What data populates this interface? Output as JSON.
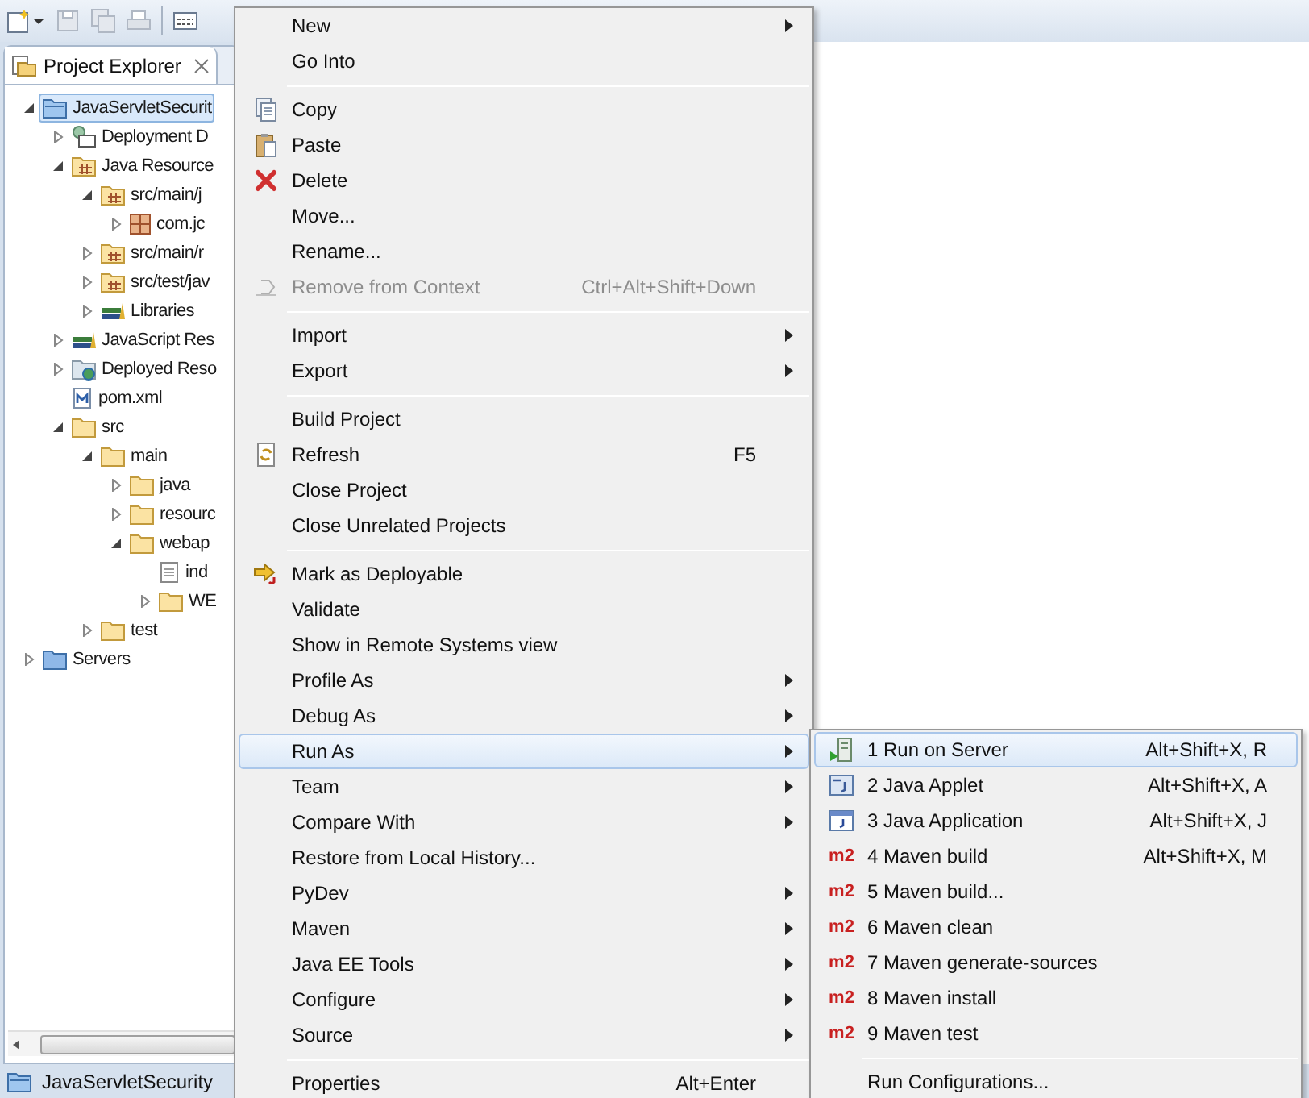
{
  "explorer": {
    "tab": {
      "title": "Project Explorer"
    },
    "tree": [
      {
        "label": "JavaServletSecurit",
        "kind": "project",
        "expanded": true,
        "selected": true,
        "children": [
          {
            "label": "Deployment D",
            "kind": "descriptor",
            "expanded": false,
            "selected": false
          },
          {
            "label": "Java Resource",
            "kind": "java-resources",
            "expanded": true,
            "selected": false,
            "children": [
              {
                "label": "src/main/j",
                "kind": "source-folder",
                "expanded": true,
                "selected": false,
                "children": [
                  {
                    "label": "com.jc",
                    "kind": "package",
                    "expanded": false,
                    "selected": false
                  }
                ]
              },
              {
                "label": "src/main/r",
                "kind": "source-folder",
                "expanded": false,
                "selected": false
              },
              {
                "label": "src/test/jav",
                "kind": "source-folder",
                "expanded": false,
                "selected": false
              },
              {
                "label": "Libraries",
                "kind": "library",
                "expanded": false,
                "selected": false
              }
            ]
          },
          {
            "label": "JavaScript Res",
            "kind": "library",
            "expanded": false,
            "selected": false
          },
          {
            "label": "Deployed Reso",
            "kind": "deployed",
            "expanded": false,
            "selected": false
          },
          {
            "label": "pom.xml",
            "kind": "maven-file",
            "selected": false
          },
          {
            "label": "src",
            "kind": "folder",
            "expanded": true,
            "selected": false,
            "children": [
              {
                "label": "main",
                "kind": "folder",
                "expanded": true,
                "selected": false,
                "children": [
                  {
                    "label": "java",
                    "kind": "folder",
                    "expanded": false,
                    "selected": false
                  },
                  {
                    "label": "resourc",
                    "kind": "folder",
                    "expanded": false,
                    "selected": false
                  },
                  {
                    "label": "webap",
                    "kind": "folder",
                    "expanded": true,
                    "selected": false,
                    "children": [
                      {
                        "label": "ind",
                        "kind": "file",
                        "selected": false
                      },
                      {
                        "label": "WE",
                        "kind": "folder",
                        "expanded": false,
                        "selected": false
                      }
                    ]
                  }
                ]
              },
              {
                "label": "test",
                "kind": "folder",
                "expanded": false,
                "selected": false
              }
            ]
          }
        ]
      },
      {
        "label": "Servers",
        "kind": "servers",
        "expanded": false,
        "selected": false
      }
    ]
  },
  "status_bar": {
    "label": "JavaServletSecurity"
  },
  "context_menu": {
    "items": [
      {
        "kind": "plain",
        "label": "New",
        "submenu": true,
        "disabled": false,
        "selected": false
      },
      {
        "kind": "plain",
        "label": "Go Into",
        "submenu": false,
        "disabled": false,
        "selected": false
      },
      {
        "kind": "separator"
      },
      {
        "kind": "copy",
        "label": "Copy",
        "submenu": false,
        "disabled": false,
        "selected": false
      },
      {
        "kind": "paste",
        "label": "Paste",
        "submenu": false,
        "disabled": false,
        "selected": false
      },
      {
        "kind": "delete",
        "label": "Delete",
        "submenu": false,
        "disabled": false,
        "selected": false
      },
      {
        "kind": "plain",
        "label": "Move...",
        "submenu": false,
        "disabled": false,
        "selected": false
      },
      {
        "kind": "plain",
        "label": "Rename...",
        "submenu": false,
        "disabled": false,
        "selected": false
      },
      {
        "kind": "remove-context",
        "label": "Remove from Context",
        "shortcut": "Ctrl+Alt+Shift+Down",
        "submenu": false,
        "disabled": true,
        "selected": false
      },
      {
        "kind": "separator"
      },
      {
        "kind": "plain",
        "label": "Import",
        "submenu": true,
        "disabled": false,
        "selected": false
      },
      {
        "kind": "plain",
        "label": "Export",
        "submenu": true,
        "disabled": false,
        "selected": false
      },
      {
        "kind": "separator"
      },
      {
        "kind": "plain",
        "label": "Build Project",
        "submenu": false,
        "disabled": false,
        "selected": false
      },
      {
        "kind": "refresh",
        "label": "Refresh",
        "shortcut": "F5",
        "submenu": false,
        "disabled": false,
        "selected": false
      },
      {
        "kind": "plain",
        "label": "Close Project",
        "submenu": false,
        "disabled": false,
        "selected": false
      },
      {
        "kind": "plain",
        "label": "Close Unrelated Projects",
        "submenu": false,
        "disabled": false,
        "selected": false
      },
      {
        "kind": "separator"
      },
      {
        "kind": "deploy",
        "label": "Mark as Deployable",
        "submenu": false,
        "disabled": false,
        "selected": false
      },
      {
        "kind": "plain",
        "label": "Validate",
        "submenu": false,
        "disabled": false,
        "selected": false
      },
      {
        "kind": "plain",
        "label": "Show in Remote Systems view",
        "submenu": false,
        "disabled": false,
        "selected": false
      },
      {
        "kind": "plain",
        "label": "Profile As",
        "submenu": true,
        "disabled": false,
        "selected": false
      },
      {
        "kind": "plain",
        "label": "Debug As",
        "submenu": true,
        "disabled": false,
        "selected": false
      },
      {
        "kind": "plain",
        "label": "Run As",
        "submenu": true,
        "disabled": false,
        "selected": true
      },
      {
        "kind": "plain",
        "label": "Team",
        "submenu": true,
        "disabled": false,
        "selected": false
      },
      {
        "kind": "plain",
        "label": "Compare With",
        "submenu": true,
        "disabled": false,
        "selected": false
      },
      {
        "kind": "plain",
        "label": "Restore from Local History...",
        "submenu": false,
        "disabled": false,
        "selected": false
      },
      {
        "kind": "plain",
        "label": "PyDev",
        "submenu": true,
        "disabled": false,
        "selected": false
      },
      {
        "kind": "plain",
        "label": "Maven",
        "submenu": true,
        "disabled": false,
        "selected": false
      },
      {
        "kind": "plain",
        "label": "Java EE Tools",
        "submenu": true,
        "disabled": false,
        "selected": false
      },
      {
        "kind": "plain",
        "label": "Configure",
        "submenu": true,
        "disabled": false,
        "selected": false
      },
      {
        "kind": "plain",
        "label": "Source",
        "submenu": true,
        "disabled": false,
        "selected": false
      },
      {
        "kind": "separator"
      },
      {
        "kind": "plain",
        "label": "Properties",
        "shortcut": "Alt+Enter",
        "submenu": false,
        "disabled": false,
        "selected": false
      }
    ]
  },
  "run_as_menu": {
    "items": [
      {
        "kind": "server",
        "label": "1 Run on Server",
        "shortcut": "Alt+Shift+X, R",
        "selected": true
      },
      {
        "kind": "applet",
        "label": "2 Java Applet",
        "shortcut": "Alt+Shift+X, A",
        "selected": false
      },
      {
        "kind": "java-app",
        "label": "3 Java Application",
        "shortcut": "Alt+Shift+X, J",
        "selected": false
      },
      {
        "kind": "maven",
        "badge": "m2",
        "label": "4 Maven build",
        "shortcut": "Alt+Shift+X, M",
        "selected": false
      },
      {
        "kind": "maven",
        "badge": "m2",
        "label": "5 Maven build...",
        "selected": false
      },
      {
        "kind": "maven",
        "badge": "m2",
        "label": "6 Maven clean",
        "selected": false
      },
      {
        "kind": "maven",
        "badge": "m2",
        "label": "7 Maven generate-sources",
        "selected": false
      },
      {
        "kind": "maven",
        "badge": "m2",
        "label": "8 Maven install",
        "selected": false
      },
      {
        "kind": "maven",
        "badge": "m2",
        "label": "9 Maven test",
        "selected": false
      },
      {
        "kind": "separator"
      },
      {
        "kind": "plain",
        "label": "Run Configurations...",
        "selected": false
      }
    ]
  }
}
